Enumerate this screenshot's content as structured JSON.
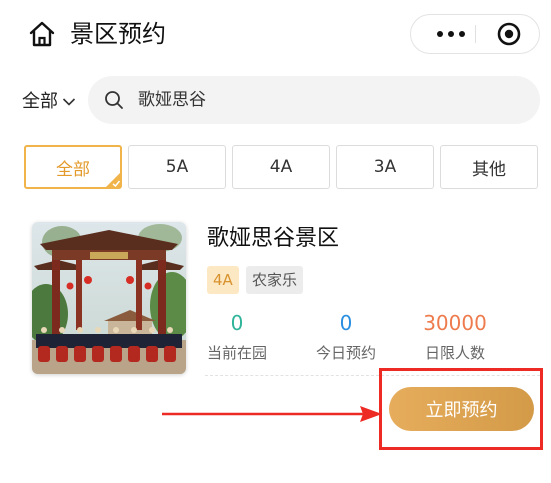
{
  "header": {
    "title": "景区预约",
    "home_icon": "home-icon",
    "more_icon": "more-dots-icon",
    "target_icon": "target-icon"
  },
  "filter": {
    "region": "全部",
    "search_value": "歌娅思谷"
  },
  "tabs": [
    {
      "label": "全部",
      "active": true
    },
    {
      "label": "5A",
      "active": false
    },
    {
      "label": "4A",
      "active": false
    },
    {
      "label": "3A",
      "active": false
    },
    {
      "label": "其他",
      "active": false
    }
  ],
  "spot": {
    "name": "歌娅思谷景区",
    "tags": [
      "4A",
      "农家乐"
    ],
    "stats": [
      {
        "value": "0",
        "label": "当前在园",
        "color": "#2fb49a"
      },
      {
        "value": "0",
        "label": "今日预约",
        "color": "#2a8fe0"
      },
      {
        "value": "30000",
        "label": "日限人数",
        "color": "#ee7b4d"
      }
    ],
    "book_label": "立即预约"
  },
  "colors": {
    "accent": "#e39a2a",
    "annotation_red": "#ee2a24"
  }
}
